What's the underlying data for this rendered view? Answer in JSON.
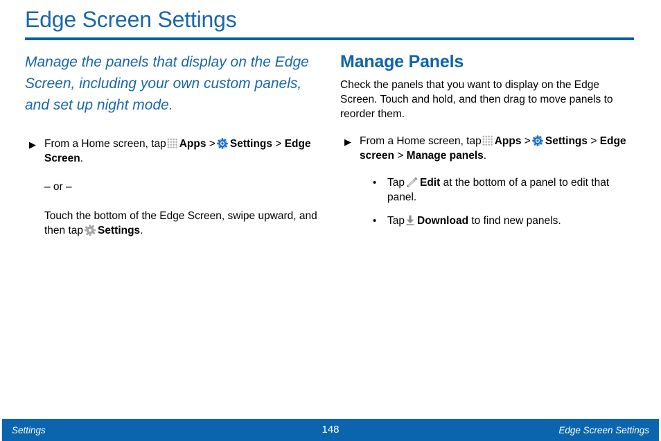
{
  "document": {
    "title": "Edge Screen Settings",
    "accent_blue": "#0060ad",
    "title_blue": "#1a66ac",
    "heading_blue": "#0f63ad",
    "footer_blue": "#0a64ae"
  },
  "left_column": {
    "intro": "Manage the panels that display on the Edge Screen, including your own custom panels, and set up night mode.",
    "step": {
      "marker": "▶",
      "text_1": "From a Home screen, tap",
      "apps_label": "Apps",
      "sep_1": ">",
      "settings_label": "Settings",
      "sep_2": ">",
      "target_label": "Edge Screen",
      "period": "."
    },
    "or_divider": "– or –",
    "alt_step": {
      "text_1": "Touch the bottom of the Edge Screen, swipe upward, and then tap",
      "settings_label": "Settings",
      "period": "."
    }
  },
  "right_column": {
    "heading": "Manage Panels",
    "paragraph": "Check the panels that you want to display on the Edge Screen. Touch and hold, and then drag to move panels to reorder them.",
    "step": {
      "marker": "▶",
      "text_1": "From a Home screen, tap",
      "apps_label": "Apps",
      "sep_1": ">",
      "settings_label": "Settings",
      "sep_2": ">",
      "target_label_1": "Edge screen",
      "sep_3": ">",
      "target_label_2": "Manage panels",
      "period": "."
    },
    "bullets": [
      {
        "marker": "•",
        "text_1": "Tap",
        "icon": "pencil-icon",
        "bold_label": "Edit",
        "text_2": "at the bottom of a panel to edit that panel."
      },
      {
        "marker": "•",
        "text_1": "Tap",
        "icon": "download-icon",
        "bold_label": "Download",
        "text_2": "to find new panels."
      }
    ]
  },
  "footer": {
    "left_label": "Settings",
    "page_number": "148",
    "right_label": "Edge Screen Settings"
  }
}
